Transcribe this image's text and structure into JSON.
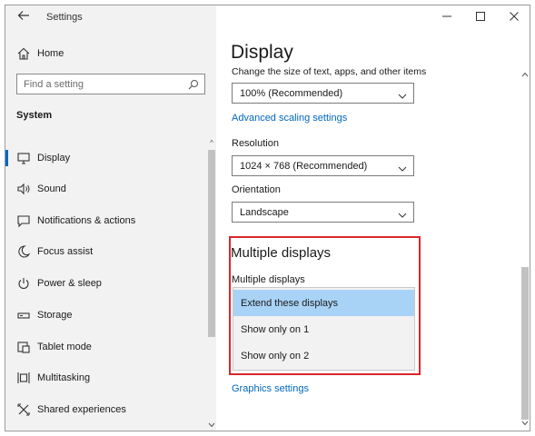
{
  "app": {
    "title": "Settings"
  },
  "sidebar": {
    "home_label": "Home",
    "search_placeholder": "Find a setting",
    "section_label": "System",
    "items": [
      {
        "label": "Display",
        "icon": "monitor-icon",
        "active": true
      },
      {
        "label": "Sound",
        "icon": "speaker-icon",
        "active": false
      },
      {
        "label": "Notifications & actions",
        "icon": "notifications-icon",
        "active": false
      },
      {
        "label": "Focus assist",
        "icon": "moon-icon",
        "active": false
      },
      {
        "label": "Power & sleep",
        "icon": "power-icon",
        "active": false
      },
      {
        "label": "Storage",
        "icon": "storage-icon",
        "active": false
      },
      {
        "label": "Tablet mode",
        "icon": "tablet-icon",
        "active": false
      },
      {
        "label": "Multitasking",
        "icon": "multitasking-icon",
        "active": false
      },
      {
        "label": "Shared experiences",
        "icon": "shared-icon",
        "active": false
      }
    ]
  },
  "main": {
    "title": "Display",
    "scale_description": "Change the size of text, apps, and other items",
    "scale_value": "100% (Recommended)",
    "advanced_scaling_link": "Advanced scaling settings",
    "resolution_label": "Resolution",
    "resolution_value": "1024 × 768 (Recommended)",
    "orientation_label": "Orientation",
    "orientation_value": "Landscape",
    "multiple_displays_title": "Multiple displays",
    "multiple_displays_label": "Multiple displays",
    "multiple_displays_options": [
      {
        "label": "Extend these displays",
        "selected": true
      },
      {
        "label": "Show only on 1",
        "selected": false
      },
      {
        "label": "Show only on 2",
        "selected": false
      }
    ],
    "graphics_link": "Graphics settings"
  },
  "colors": {
    "accent": "#0067c0",
    "highlight_border": "#d9262b",
    "selected_option": "#a9d3f6",
    "sidebar_bg": "#f2f2f2"
  }
}
